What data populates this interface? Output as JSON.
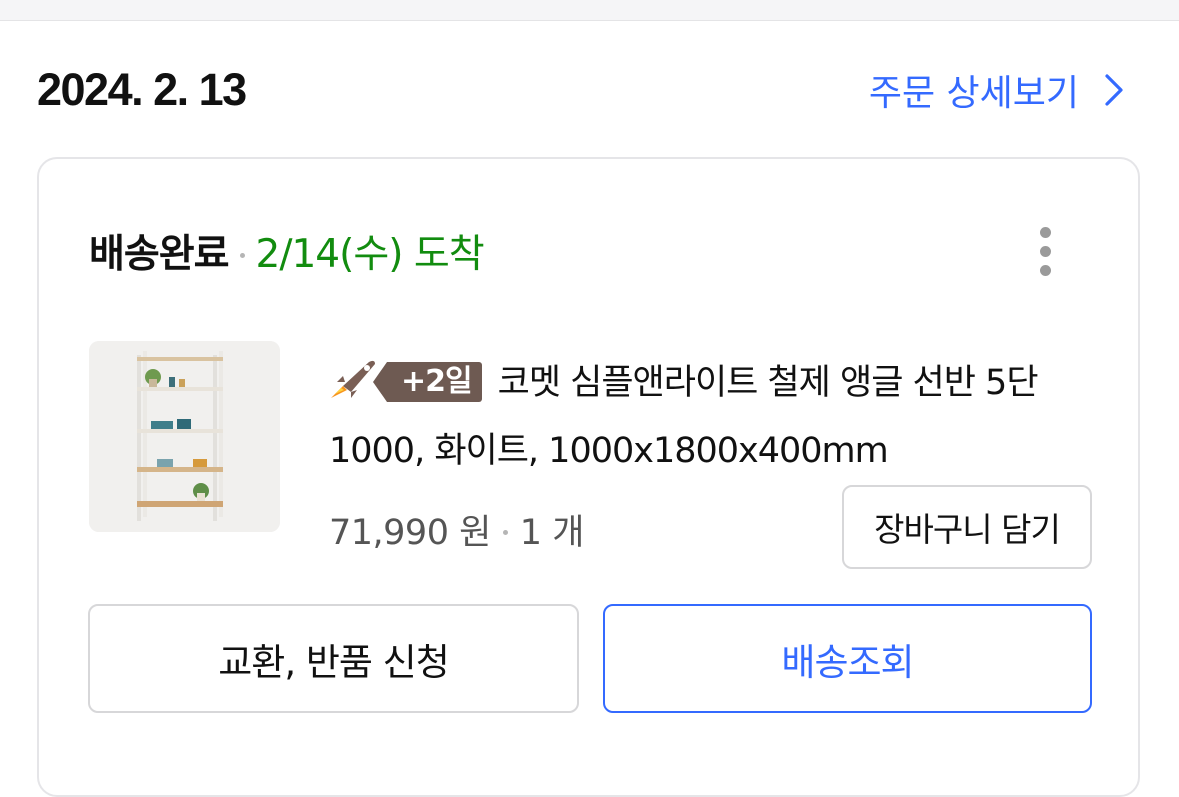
{
  "order": {
    "date": "2024. 2. 13",
    "detail_link_label": "주문 상세보기"
  },
  "shipment": {
    "status": "배송완료",
    "arrival": "2/14(수) 도착"
  },
  "product": {
    "rocket_badge": "+2일",
    "title": "코멧 심플앤라이트 철제 앵글 선반 5단 1000, 화이트, 1000x1800x400mm",
    "price": "71,990 원",
    "quantity": "1 개"
  },
  "buttons": {
    "add_to_cart": "장바구니 담기",
    "exchange_return": "교환, 반품 신청",
    "track_delivery": "배송조회"
  },
  "colors": {
    "accent_blue": "#346aff",
    "arrival_green": "#128c0f",
    "badge_brown": "#6e5a52"
  },
  "icons": {
    "detail_chevron": "chevron-right-icon",
    "more": "more-vertical-icon",
    "rocket": "rocket-icon"
  }
}
